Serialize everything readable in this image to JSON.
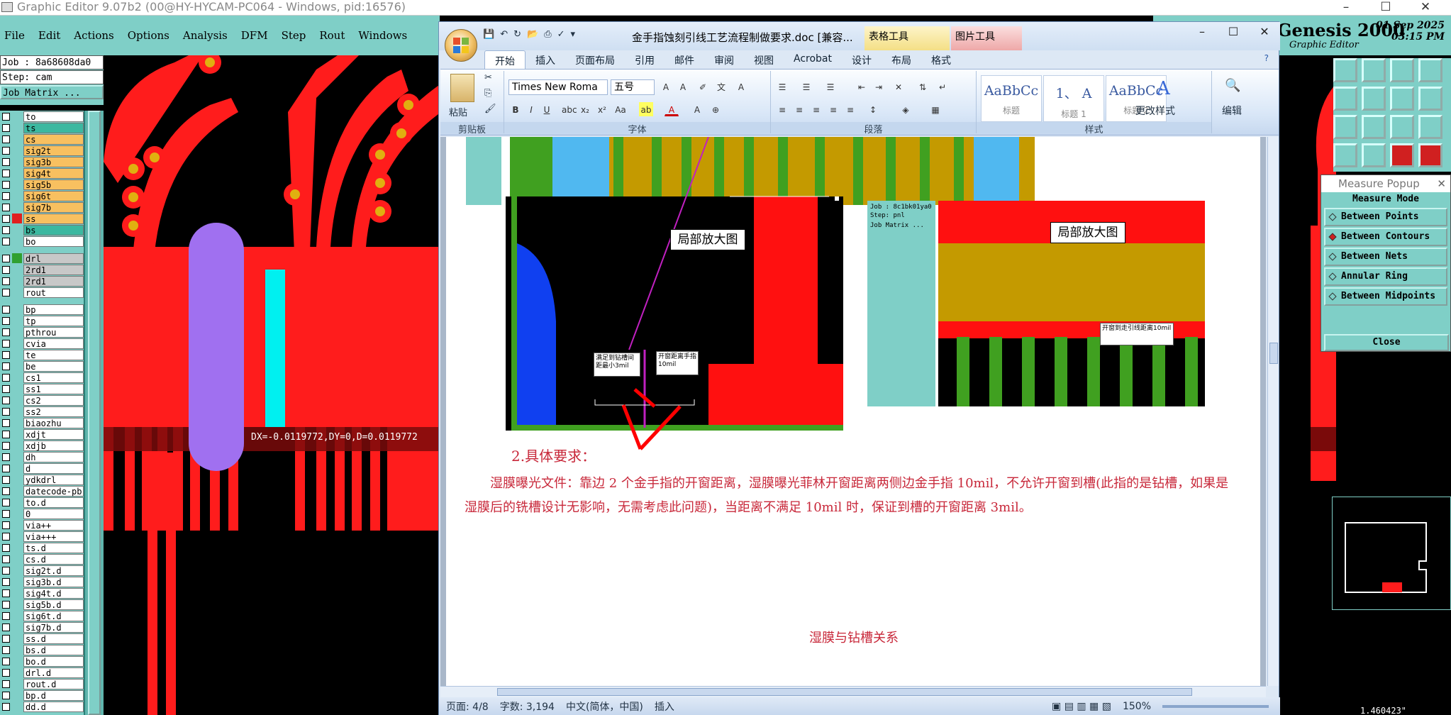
{
  "genesis": {
    "window_title": "Graphic Editor 9.07b2 (00@HY-HYCAM-PC064 - Windows, pid:16576)",
    "menu": [
      "File",
      "Edit",
      "Actions",
      "Options",
      "Analysis",
      "DFM",
      "Step",
      "Rout",
      "Windows"
    ],
    "job": "Job : 8a68608da0",
    "step": "Step: cam",
    "job_matrix": "Job Matrix ...",
    "layers_group1": [
      "to",
      "ts",
      "cs",
      "sig2t",
      "sig3b",
      "sig4t",
      "sig5b",
      "sig6t",
      "sig7b",
      "ss",
      "bs",
      "bo"
    ],
    "layers_group2": [
      "drl",
      "2rd1",
      "2rd1",
      "rout"
    ],
    "layers_group3": [
      "bp",
      "tp",
      "pthrou",
      "cvia",
      "te",
      "be",
      "cs1",
      "ss1",
      "cs2",
      "ss2",
      "biaozhu",
      "xdjt",
      "xdjb",
      "dh",
      "d",
      "ydkdrl",
      "datecode-pb",
      "to.d",
      "0",
      "via++",
      "via+++",
      "ts.d",
      "cs.d",
      "sig2t.d",
      "sig3b.d",
      "sig4t.d",
      "sig5b.d",
      "sig6t.d",
      "sig7b.d",
      "ss.d",
      "bs.d",
      "bo.d",
      "drl.d",
      "rout.d",
      "bp.d",
      "dd.d"
    ],
    "measure_readout": "DX=-0.0119772,DY=0,D=0.0119772",
    "logo": "Genesis 2000",
    "logo_sub": "Graphic Editor",
    "date": "01 Sep 2025",
    "time": "03:15 PM",
    "coord_readout": "1.460423\"",
    "colors": {
      "panel": "#7fcfc7",
      "trace": "#ff1c1c",
      "pad_center": "#e0b010",
      "cyan": "#00f0f0",
      "purple": "#a070f0"
    }
  },
  "measure_popup": {
    "title": "Measure Popup",
    "mode_label": "Measure Mode",
    "options": [
      "Between Points",
      "Between Contours",
      "Between Nets",
      "Annular Ring",
      "Between Midpoints"
    ],
    "selected": "Between Contours",
    "close_label": "Close"
  },
  "word": {
    "doc_title": "金手指蚀刻引线工艺流程制做要求.doc [兼容...",
    "ctx_table_tools": "表格工具",
    "ctx_picture_tools": "图片工具",
    "tabs": [
      "开始",
      "插入",
      "页面布局",
      "引用",
      "邮件",
      "审阅",
      "视图",
      "Acrobat",
      "设计",
      "布局",
      "格式"
    ],
    "active_tab": "开始",
    "groups": {
      "clipboard": "剪贴板",
      "font": "字体",
      "paragraph": "段落",
      "styles": "样式"
    },
    "paste_label": "粘贴",
    "font_name": "Times New Roma",
    "font_size": "五号",
    "styles": [
      {
        "sample": "AaBbCc",
        "name": "标题"
      },
      {
        "sample": "1、 A",
        "name": "标题 1"
      },
      {
        "sample": "AaBbCc",
        "name": "标题 2"
      }
    ],
    "change_styles": "更改样式",
    "edit_label": "编辑",
    "doc": {
      "callout_left": "局部放大图",
      "callout_right": "局部放大图",
      "note1": "满足到钻槽间距最小3mil",
      "note2": "开窗距离手指10mil",
      "note3": "开窗到走引线距离10mil",
      "heading": "2.具体要求：",
      "paragraph": "湿膜曝光文件：靠边 2 个金手指的开窗距离，湿膜曝光菲林开窗距离两侧边金手指 10mil，不允许开窗到槽(此指的是钻槽，如果是湿膜后的铣槽设计无影响，无需考虑此问题)，当距离不满足 10mil 时，保证到槽的开窗距离 3mil。",
      "caption": "湿膜与钻槽关系",
      "mini_job": "Job : 8c1bk01ya0",
      "mini_step": "Step: pnl",
      "mini_matrix": "Job Matrix ..."
    },
    "status": {
      "page": "页面: 4/8",
      "words": "字数: 3,194",
      "lang": "中文(简体，中国)",
      "mode": "插入",
      "zoom": "150%"
    }
  }
}
